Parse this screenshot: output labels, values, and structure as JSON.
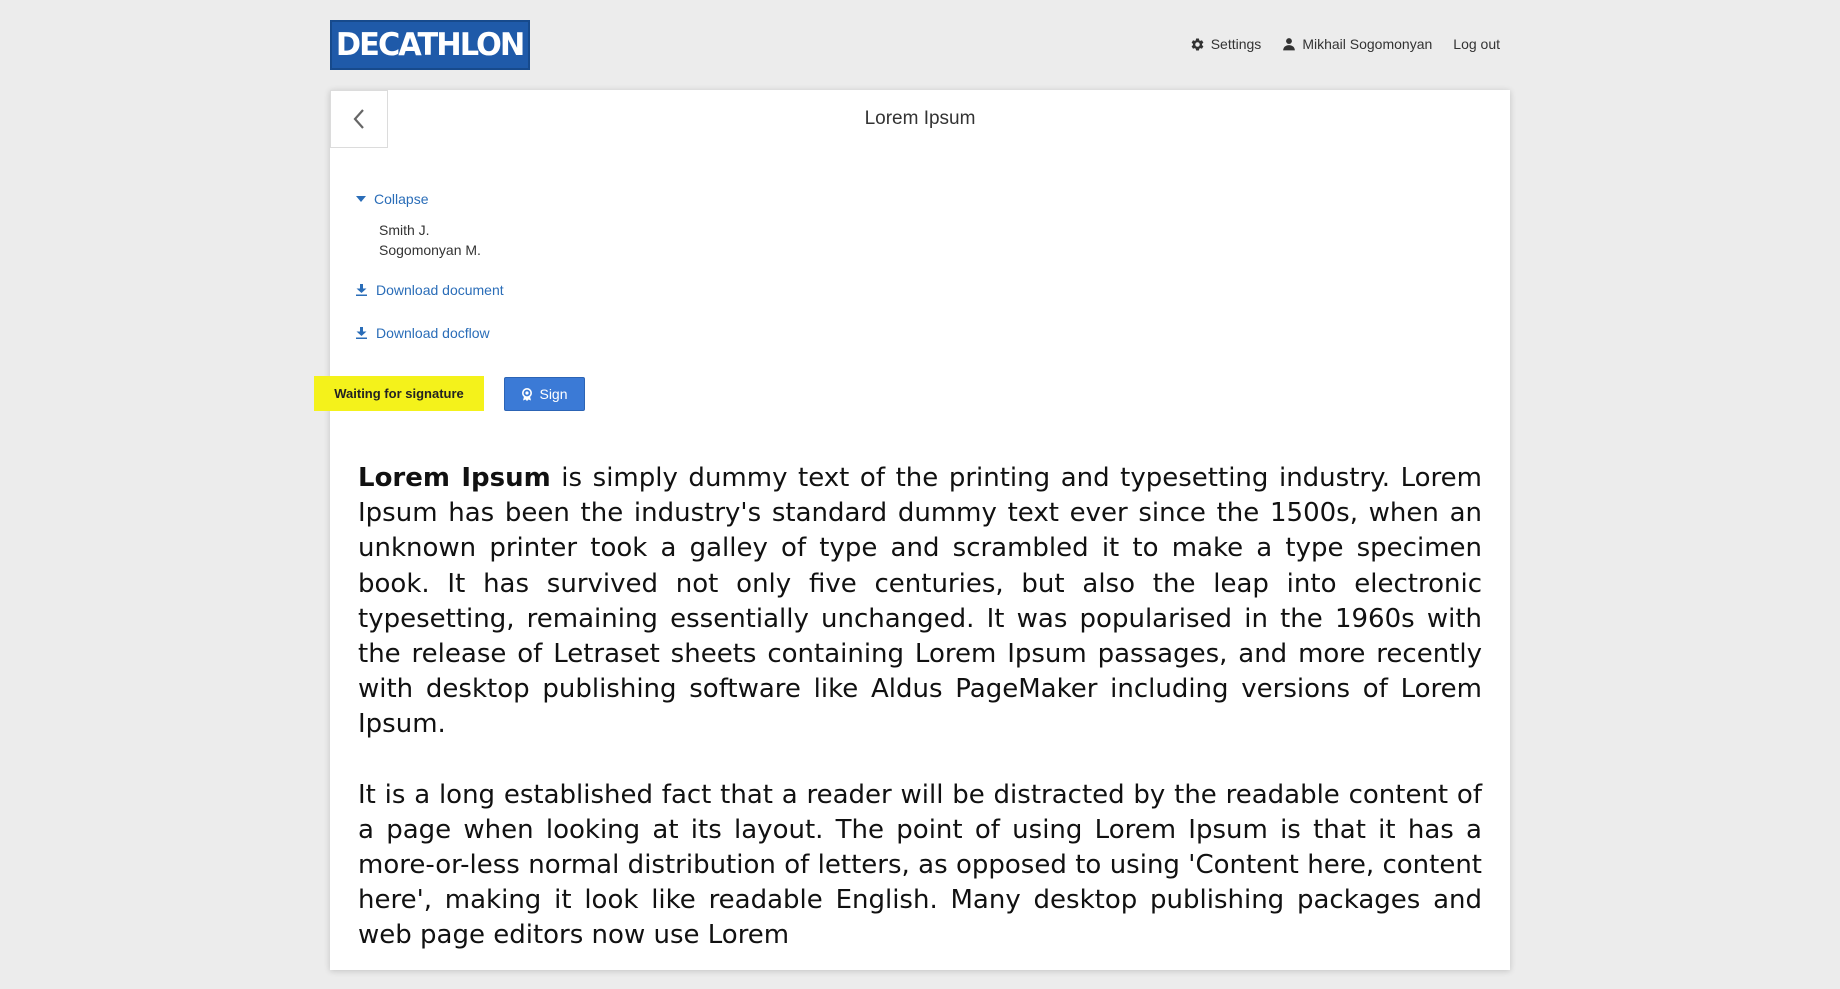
{
  "header": {
    "logo_text": "DECATHLON",
    "nav": {
      "settings_label": "Settings",
      "user_label": "Mikhail Sogomonyan",
      "logout_label": "Log out"
    }
  },
  "document": {
    "title": "Lorem Ipsum",
    "collapse_label": "Collapse",
    "signers": [
      "Smith J.",
      "Sogomonyan M."
    ],
    "download_document_label": "Download document",
    "download_docflow_label": "Download docflow",
    "status_label": "Waiting for signature",
    "sign_label": "Sign",
    "paragraph1_lead": "Lorem Ipsum",
    "paragraph1_rest": " is simply dummy text of the printing and typesetting industry. Lorem Ipsum has been the industry's standard dummy text ever since the 1500s, when an unknown printer took a galley of type and scrambled it to make a type specimen book. It has survived not only five centuries, but also the leap into electronic typesetting, remaining essentially unchanged. It was popularised in the 1960s with the release of Letraset sheets containing Lorem Ipsum passages, and more recently with desktop publishing software like Aldus PageMaker including versions of Lorem Ipsum.",
    "paragraph2": "It is a long established fact that a reader will be distracted by the readable content of a page when looking at its layout. The point of using Lorem Ipsum is that it has a more-or-less normal distribution of letters, as opposed to using 'Content here, content here', making it look like readable English. Many desktop publishing packages and web page editors now use Lorem"
  },
  "colors": {
    "background": "#ececec",
    "brand_blue": "#1f5aa9",
    "link_blue": "#2a6db8",
    "button_blue": "#3b7ad6",
    "status_yellow": "#f4f21b"
  },
  "icons": {
    "settings": "gear-icon",
    "user": "user-icon",
    "back": "chevron-left-icon",
    "collapse": "caret-down-icon",
    "download": "download-icon",
    "sign": "seal-icon"
  }
}
